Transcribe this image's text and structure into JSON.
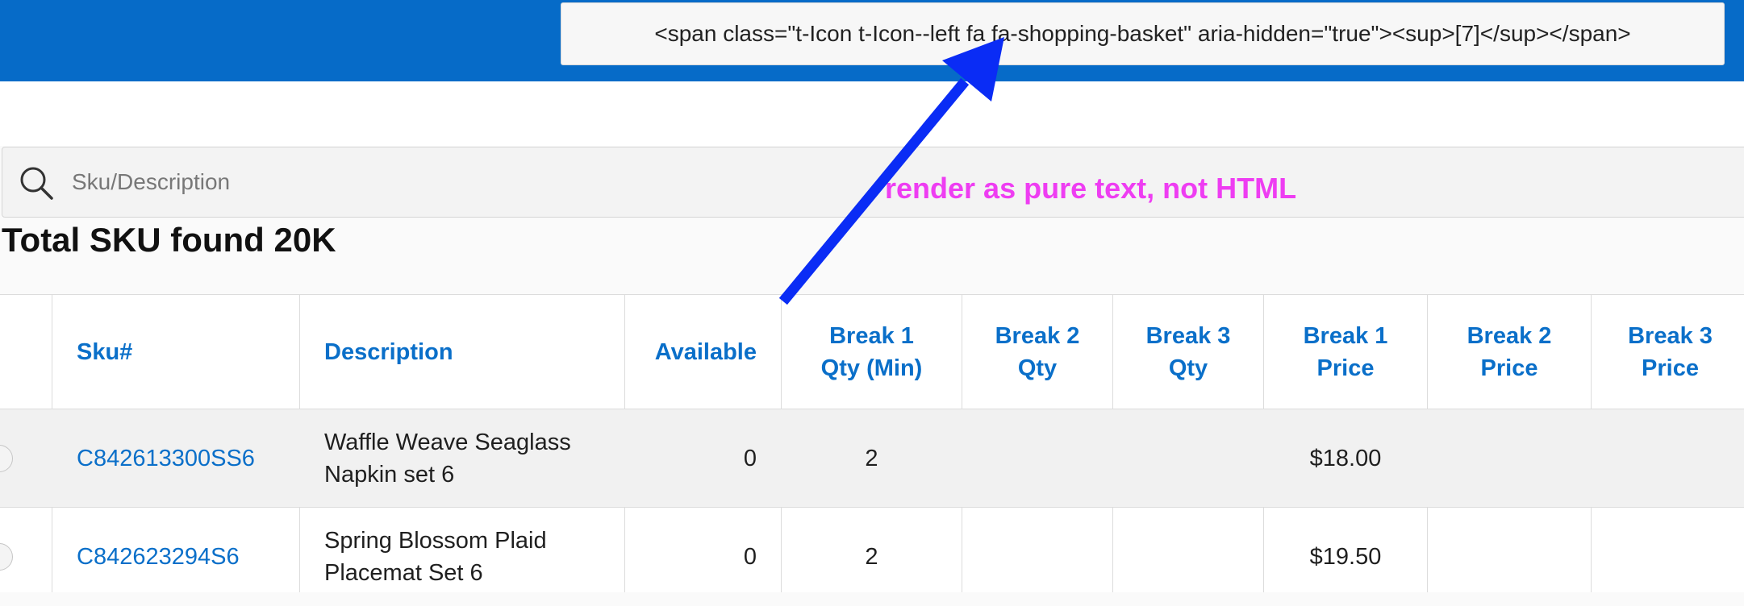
{
  "tooltip": {
    "code_text": "<span class=\"t-Icon t-Icon--left fa fa-shopping-basket\" aria-hidden=\"true\"><sup>[7]</sup></span>"
  },
  "search": {
    "placeholder": "Sku/Description",
    "value": ""
  },
  "annotation": {
    "text": "render as pure text, not HTML",
    "color": "#ee3df2",
    "arrow_color": "#0a2cf5"
  },
  "summary": {
    "total_text": "Total SKU found 20K"
  },
  "table": {
    "headers": {
      "sku": "Sku#",
      "description": "Description",
      "available": "Available",
      "break1_qty": "Break 1 Qty (Min)",
      "break2_qty": "Break 2 Qty",
      "break3_qty": "Break 3 Qty",
      "break1_price": "Break 1 Price",
      "break2_price": "Break 2 Price",
      "break3_price": "Break 3 Price"
    },
    "rows": [
      {
        "sku": "C842613300SS6",
        "description": "Waffle Weave Seaglass Napkin set 6",
        "available": "0",
        "break1_qty": "2",
        "break2_qty": "",
        "break3_qty": "",
        "break1_price": "$18.00",
        "break2_price": "",
        "break3_price": ""
      },
      {
        "sku": "C842623294S6",
        "description": "Spring Blossom Plaid Placemat Set 6",
        "available": "0",
        "break1_qty": "2",
        "break2_qty": "",
        "break3_qty": "",
        "break1_price": "$19.50",
        "break2_price": "",
        "break3_price": ""
      }
    ]
  },
  "colors": {
    "topbar": "#066bc8",
    "link": "#0a6fc9"
  }
}
